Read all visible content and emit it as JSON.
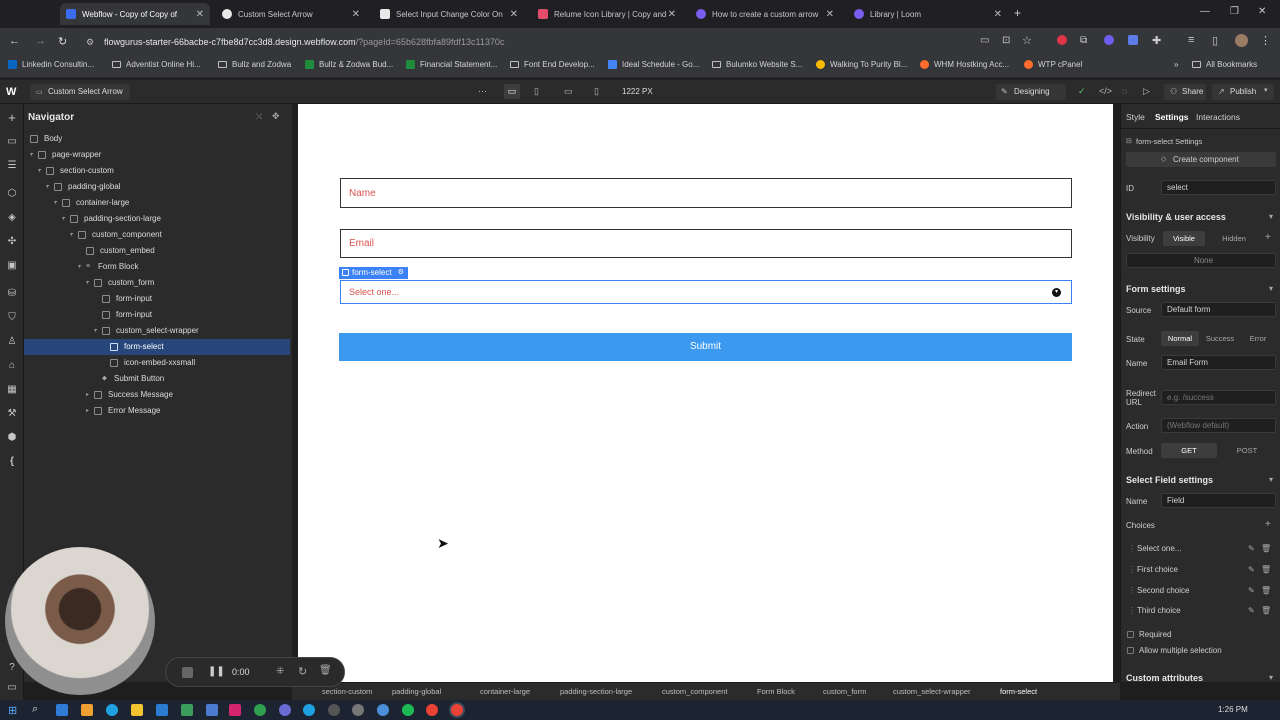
{
  "browser": {
    "tabs": [
      {
        "label": "Webflow - Copy of Copy of",
        "active": true,
        "color": "#3a6df0"
      },
      {
        "label": "Custom Select Arrow",
        "active": false,
        "color": "#e8e8e8"
      },
      {
        "label": "Select Input Change Color On",
        "active": false,
        "color": "#e8e8e8"
      },
      {
        "label": "Relume Icon Library | Copy and",
        "active": false,
        "color": "#e14d6a"
      },
      {
        "label": "How to create a custom arrow",
        "active": false,
        "color": "#7a5cf0"
      },
      {
        "label": "Library | Loom",
        "active": false,
        "color": "#7a5cf0"
      }
    ],
    "url_host": "flowgurus-starter-66bacbe-c7fbe8d7cc3d8.design.webflow.com",
    "url_rest": "/?pageId=65b628fbfa89fdf13c11370c",
    "bookmarks": [
      "Linkedin Consultin...",
      "Adventist Online Hi...",
      "Bullz and Zodwa",
      "Bullz & Zodwa Bud...",
      "Financial Statement...",
      "Font End Develop...",
      "Ideal Schedule - Go...",
      "Bulumko Website S...",
      "Walking To Purity Bl...",
      "WHM Hostking Acc...",
      "WTP cPanel"
    ],
    "all_bookmarks": "All Bookmarks"
  },
  "webflow_bar": {
    "page_name": "Custom Select Arrow",
    "width_readout": "1222 PX",
    "mode": "Designing",
    "share": "Share",
    "publish": "Publish"
  },
  "navigator": {
    "title": "Navigator",
    "items": [
      "Body",
      "page-wrapper",
      "section-custom",
      "padding-global",
      "container-large",
      "padding-section-large",
      "custom_component",
      "custom_embed",
      "Form Block",
      "custom_form",
      "form-input",
      "form-input",
      "custom_select-wrapper",
      "form-select",
      "icon-embed-xxsmall",
      "Submit Button",
      "Success Message",
      "Error Message"
    ]
  },
  "canvas": {
    "name_placeholder": "Name",
    "email_placeholder": "Email",
    "select_label": "form-select",
    "select_value": "Select one...",
    "submit_label": "Submit"
  },
  "settings": {
    "tabs": [
      "Style",
      "Settings",
      "Interactions"
    ],
    "element_heading": "form-select Settings",
    "create_component": "Create component",
    "id_label": "ID",
    "id_value": "select",
    "visibility_heading": "Visibility & user access",
    "visibility_label": "Visibility",
    "visible": "Visible",
    "hidden": "Hidden",
    "none": "None",
    "form_settings": "Form settings",
    "source_label": "Source",
    "source_value": "Default form",
    "state_label": "State",
    "states": [
      "Normal",
      "Success",
      "Error"
    ],
    "name_label": "Name",
    "form_name": "Email Form",
    "redirect_label": "Redirect URL",
    "redirect_placeholder": "e.g. /success",
    "action_label": "Action",
    "action_placeholder": "(Webflow default)",
    "method_label": "Method",
    "methods": [
      "GET",
      "POST"
    ],
    "select_field_settings": "Select Field settings",
    "field_name_label": "Name",
    "field_name_value": "Field",
    "choices_label": "Choices",
    "choices": [
      "Select one...",
      "First choice",
      "Second choice",
      "Third choice"
    ],
    "required": "Required",
    "allow_multiple": "Allow multiple selection",
    "custom_attributes": "Custom attributes"
  },
  "breadcrumbs": [
    "section-custom",
    "padding-global",
    "container-large",
    "padding-section-large",
    "custom_component",
    "Form Block",
    "custom_form",
    "custom_select-wrapper",
    "form-select"
  ],
  "recording": {
    "time": "0:00"
  },
  "clock": "1:26 PM"
}
